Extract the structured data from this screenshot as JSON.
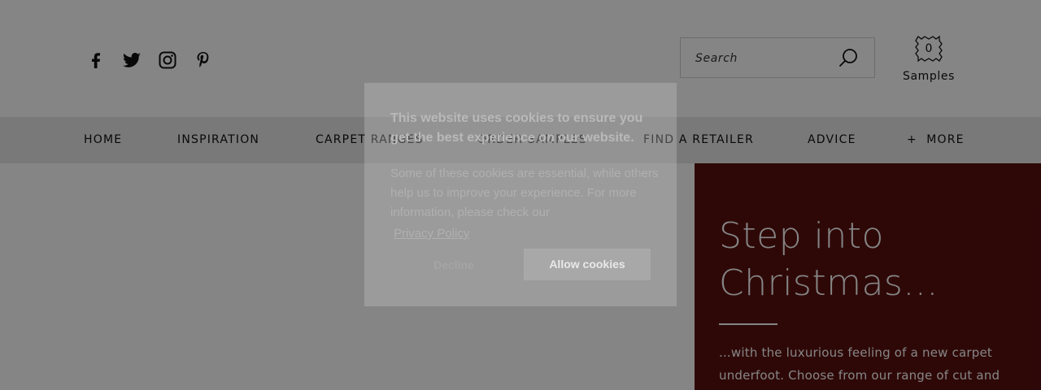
{
  "header": {
    "social": [
      {
        "icon": "facebook-icon"
      },
      {
        "icon": "twitter-icon"
      },
      {
        "icon": "instagram-icon"
      },
      {
        "icon": "pinterest-icon"
      }
    ],
    "search": {
      "placeholder": "Search",
      "value": ""
    },
    "samples": {
      "count": "0",
      "label": "Samples"
    }
  },
  "nav": {
    "items": [
      {
        "label": "HOME"
      },
      {
        "label": "INSPIRATION"
      },
      {
        "label": "CARPET RANGES"
      },
      {
        "label": "ORDER SAMPLES"
      },
      {
        "label": "FIND A RETAILER"
      },
      {
        "label": "ADVICE"
      },
      {
        "label": "+  MORE"
      }
    ]
  },
  "hero": {
    "title": "Step into Christmas...",
    "text": "...with the luxurious feeling of a new carpet underfoot. Choose from our range of cut and"
  },
  "cookie_banner": {
    "title": "This website uses cookies to ensure you get the best experience on our website.",
    "body": "Some of these cookies are essential, while others help us to improve your experience. For more information, please check our",
    "link": "Privacy Policy",
    "decline": "Decline",
    "allow": "Allow cookies"
  },
  "colors": {
    "hero_bg": "#59100f",
    "overlay": "rgba(0,0,0,0.48)",
    "allow_button": "#a8a8a8"
  }
}
